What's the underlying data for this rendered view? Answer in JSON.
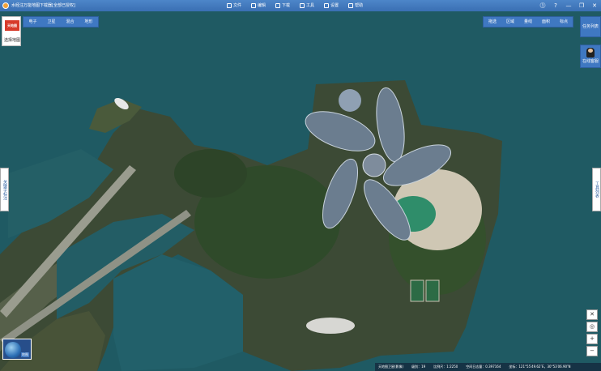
{
  "window": {
    "title": "水经注万能地图下载器[全部已授权]",
    "menu": [
      "文件",
      "编辑",
      "下载",
      "工具",
      "设置",
      "帮助"
    ],
    "controls": [
      "⓵",
      "?",
      "—",
      "❐",
      "✕"
    ]
  },
  "map_tabs": [
    "电子",
    "卫星",
    "混合",
    "地形"
  ],
  "logo": {
    "text": "天地图",
    "label": "选择地图"
  },
  "tools": [
    "拖选",
    "区域",
    "量线",
    "面积",
    "标点"
  ],
  "task_list_label": "任务列表",
  "support_label": "在线客服",
  "left_tab_label": "关键字标注",
  "right_tab_label": "工具列表",
  "zoom_controls": [
    "✕",
    "◎",
    "+",
    "−"
  ],
  "minimap_label": "地图",
  "status": {
    "map": "天地图卫星(影像)",
    "level": "级别：19",
    "scale": "比例尺：1:2250",
    "memory": "空间日志量：0.397164",
    "coords": "坐标：121°55′49.62″E，30°53′06.90″N"
  },
  "colors": {
    "sea": "#1f5a63",
    "bar": "#3f78c2",
    "land": "#3c4a35"
  }
}
